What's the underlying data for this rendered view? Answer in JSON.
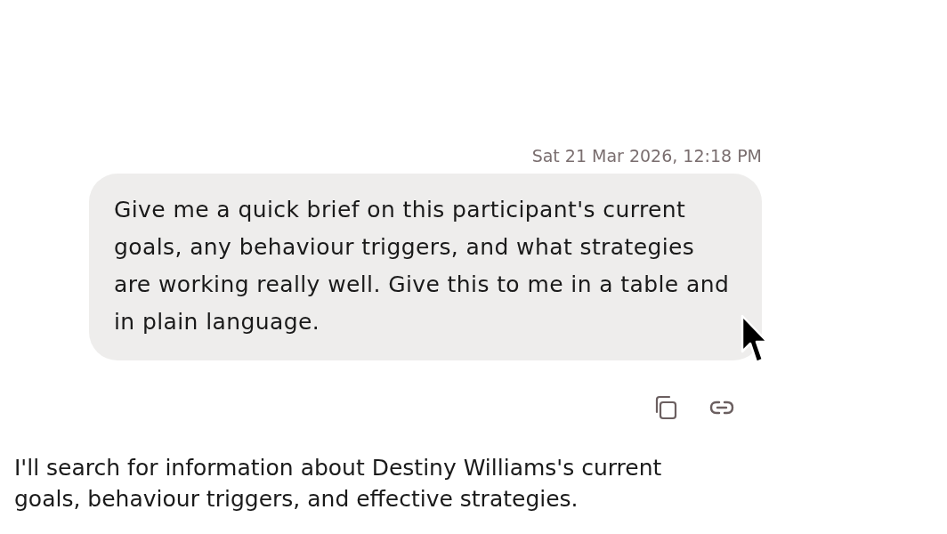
{
  "user_message": {
    "timestamp": "Sat 21 Mar 2026, 12:18 PM",
    "text": "Give me a quick brief on this participant's current goals, any behaviour triggers, and what strategies are working really well. Give this to me in a table and in plain language.",
    "actions": [
      {
        "kind": "copy"
      },
      {
        "kind": "link"
      }
    ]
  },
  "assistant_message": {
    "text": "I'll search for information about Destiny Williams's current goals, behaviour triggers, and effective strategies."
  }
}
